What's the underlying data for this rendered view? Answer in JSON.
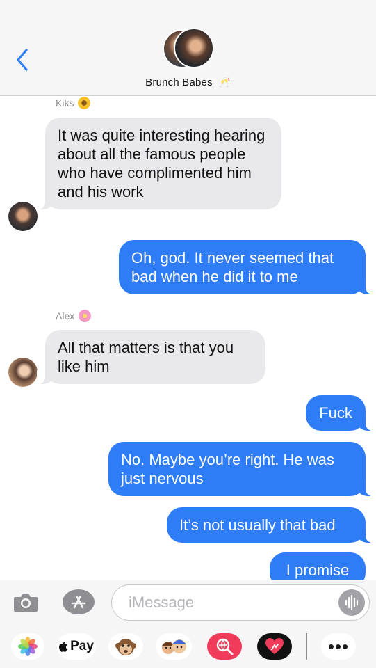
{
  "header": {
    "back_icon": "chevron-left-icon",
    "group_name": "Brunch Babes",
    "group_emoji": "🥂"
  },
  "messages": [
    {
      "type": "sender",
      "name": "Kiks",
      "emoji": "🌻"
    },
    {
      "type": "incoming",
      "text": "It was quite interesting hearing about all the famous people who have complimented him and his work"
    },
    {
      "type": "outgoing",
      "text": "Oh, god. It never seemed that bad when he did it to me"
    },
    {
      "type": "sender",
      "name": "Alex",
      "emoji": "🌸"
    },
    {
      "type": "incoming",
      "text": "All that matters is that you like him"
    },
    {
      "type": "outgoing",
      "text": "Fuck"
    },
    {
      "type": "outgoing",
      "text": "No. Maybe you’re right. He was just nervous"
    },
    {
      "type": "outgoing",
      "text": "It’s not usually that bad"
    },
    {
      "type": "outgoing",
      "text": "I promise"
    }
  ],
  "input": {
    "placeholder": "iMessage",
    "camera_icon": "camera-icon",
    "apps_icon": "app-store-icon",
    "audio_icon": "audio-waveform-icon"
  },
  "app_drawer": {
    "apps": [
      "photos-icon",
      "apple-pay-icon",
      "animoji-icon",
      "memoji-icon",
      "web-images-icon",
      "digital-touch-icon",
      "more-icon"
    ],
    "apple_pay_label": "Pay",
    "more_label": "•••"
  },
  "colors": {
    "outgoing_bubble": "#2f7df6",
    "incoming_bubble": "#e9e9eb",
    "accent": "#2f7df6"
  }
}
